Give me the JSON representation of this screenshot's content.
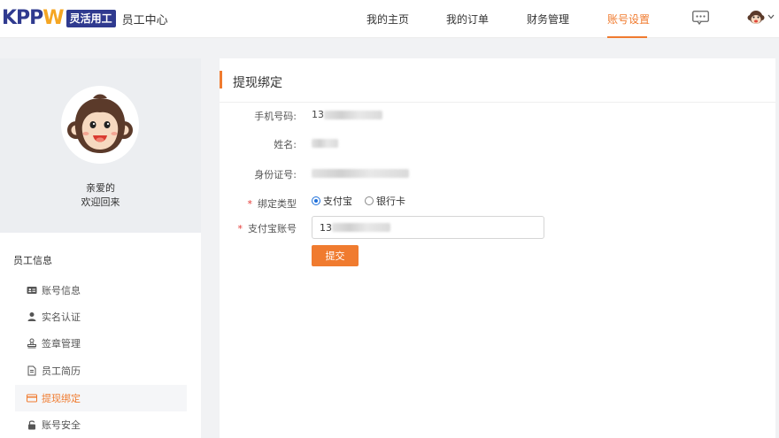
{
  "header": {
    "logo_text": "KPPW",
    "logo_badge": "灵活用工",
    "subtitle": "员工中心",
    "nav": [
      {
        "label": "我的主页"
      },
      {
        "label": "我的订单"
      },
      {
        "label": "财务管理"
      },
      {
        "label": "账号设置",
        "active": true
      }
    ],
    "message_icon": "chat-bubble-icon",
    "avatar_icon": "monkey-avatar-icon",
    "accent_color": "#f07b2f"
  },
  "profile": {
    "greeting_line1": "亲爱的",
    "greeting_line2": "欢迎回来"
  },
  "sidebar": {
    "section_title": "员工信息",
    "items": [
      {
        "label": "账号信息",
        "icon": "id-card-icon"
      },
      {
        "label": "实名认证",
        "icon": "user-icon"
      },
      {
        "label": "签章管理",
        "icon": "stamp-icon"
      },
      {
        "label": "员工简历",
        "icon": "document-icon"
      },
      {
        "label": "提现绑定",
        "icon": "card-icon",
        "active": true
      },
      {
        "label": "账号安全",
        "icon": "lock-icon"
      }
    ]
  },
  "main": {
    "title": "提现绑定",
    "fields": {
      "phone_label": "手机号码:",
      "phone_value": "13",
      "name_label": "姓名:",
      "id_label": "身份证号:",
      "bind_type_label": "绑定类型",
      "account_label": "支付宝账号",
      "account_value": "13"
    },
    "radio_options": [
      {
        "label": "支付宝",
        "checked": true
      },
      {
        "label": "银行卡",
        "checked": false
      }
    ],
    "submit_label": "提交"
  }
}
